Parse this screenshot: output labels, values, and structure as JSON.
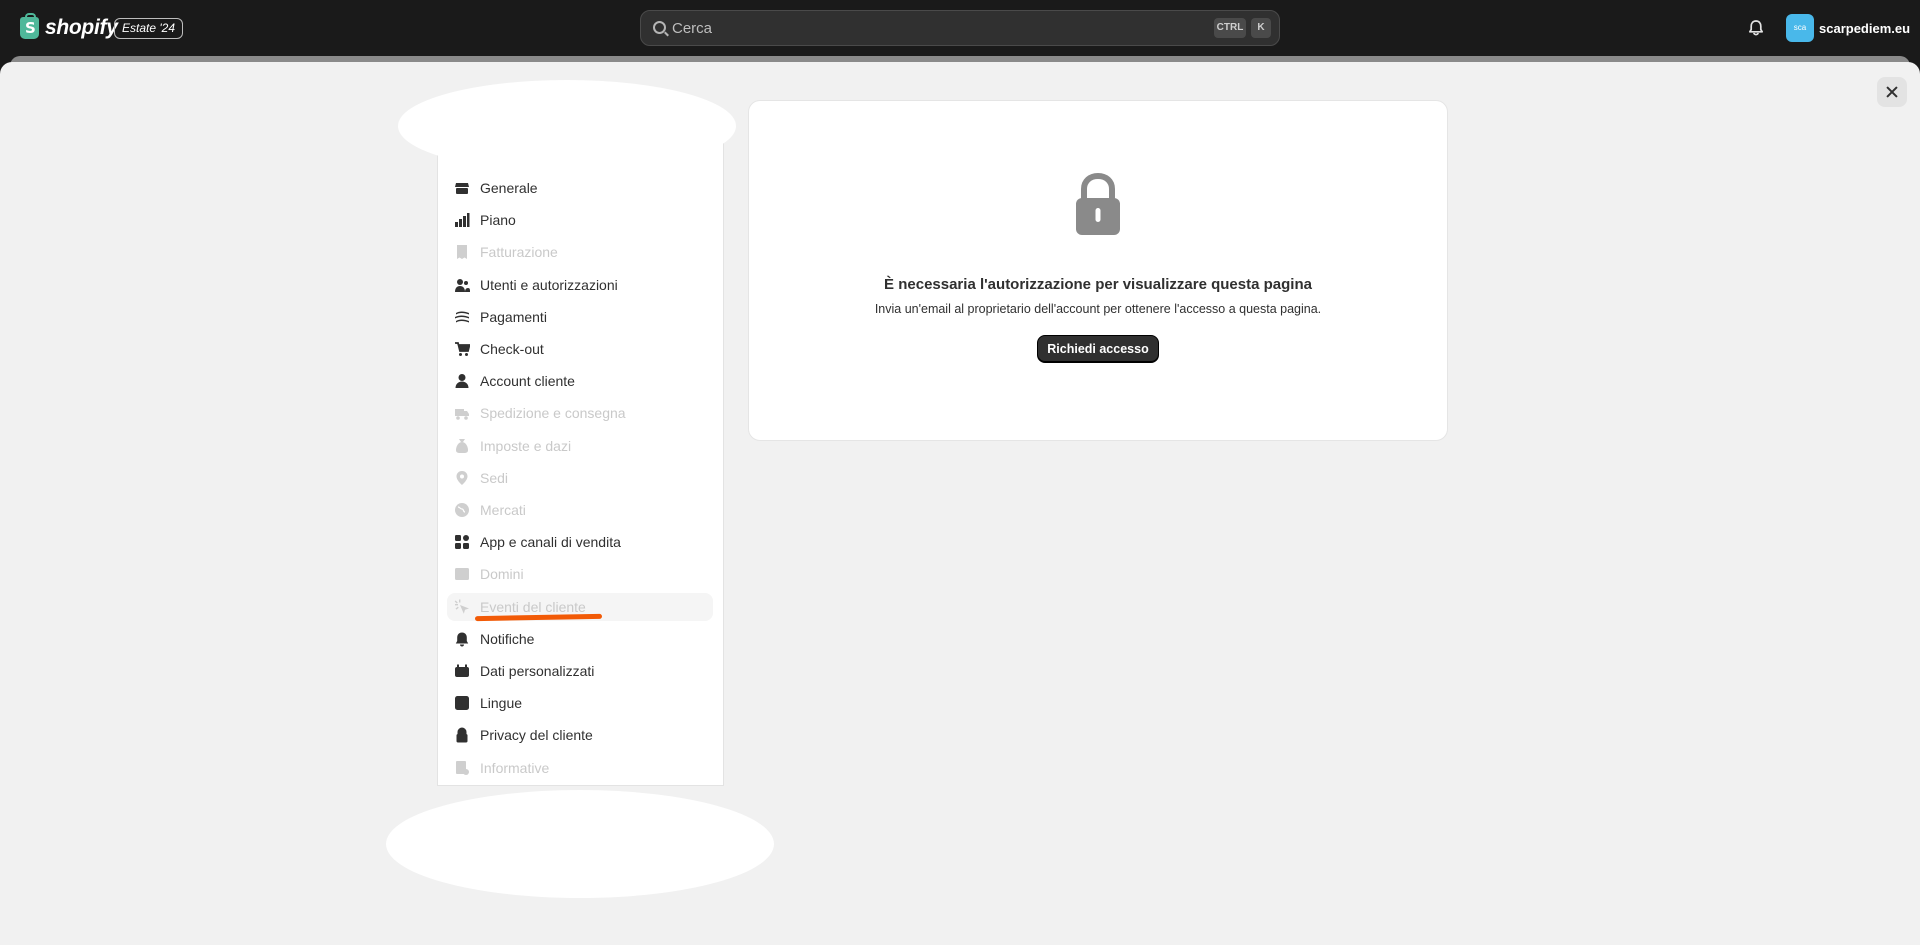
{
  "topbar": {
    "logo_text": "shopify",
    "logo_mark": "S",
    "edition_badge": "Estate '24",
    "search": {
      "placeholder": "Cerca",
      "shortcut_ctrl": "CTRL",
      "shortcut_key": "K"
    },
    "store": {
      "avatar_text": "sca",
      "name": "scarpediem.eu",
      "avatar_color": "#49b8ea"
    }
  },
  "settings_nav": {
    "items": [
      {
        "label": "Generale",
        "icon": "store-icon",
        "disabled": false
      },
      {
        "label": "Piano",
        "icon": "plan-icon",
        "disabled": false
      },
      {
        "label": "Fatturazione",
        "icon": "receipt-icon",
        "disabled": true
      },
      {
        "label": "Utenti e autorizzazioni",
        "icon": "users-icon",
        "disabled": false
      },
      {
        "label": "Pagamenti",
        "icon": "payments-icon",
        "disabled": false
      },
      {
        "label": "Check-out",
        "icon": "cart-icon",
        "disabled": false
      },
      {
        "label": "Account cliente",
        "icon": "person-icon",
        "disabled": false
      },
      {
        "label": "Spedizione e consegna",
        "icon": "truck-icon",
        "disabled": true
      },
      {
        "label": "Imposte e dazi",
        "icon": "tax-icon",
        "disabled": true
      },
      {
        "label": "Sedi",
        "icon": "location-icon",
        "disabled": true
      },
      {
        "label": "Mercati",
        "icon": "globe-icon",
        "disabled": true
      },
      {
        "label": "App e canali di vendita",
        "icon": "apps-icon",
        "disabled": false
      },
      {
        "label": "Domini",
        "icon": "domain-icon",
        "disabled": true
      },
      {
        "label": "Eventi del cliente",
        "icon": "cursor-icon",
        "disabled": true,
        "active": true
      },
      {
        "label": "Notifiche",
        "icon": "bell-icon",
        "disabled": false
      },
      {
        "label": "Dati personalizzati",
        "icon": "database-icon",
        "disabled": false
      },
      {
        "label": "Lingue",
        "icon": "language-icon",
        "disabled": false
      },
      {
        "label": "Privacy del cliente",
        "icon": "lock-icon",
        "disabled": false
      },
      {
        "label": "Informative",
        "icon": "policy-icon",
        "disabled": true
      }
    ]
  },
  "permission_card": {
    "title": "È necessaria l'autorizzazione per visualizzare questa pagina",
    "description": "Invia un'email al proprietario dell'account per ottenere l'accesso a questa pagina.",
    "button_label": "Richiedi accesso",
    "icon": "padlock-icon"
  },
  "colors": {
    "topbar": "#1a1a1a",
    "sheet": "#f1f1f1",
    "annotation_underline": "#f25a06",
    "primary_button": "#303030",
    "disabled_text": "#c9c9c9"
  }
}
